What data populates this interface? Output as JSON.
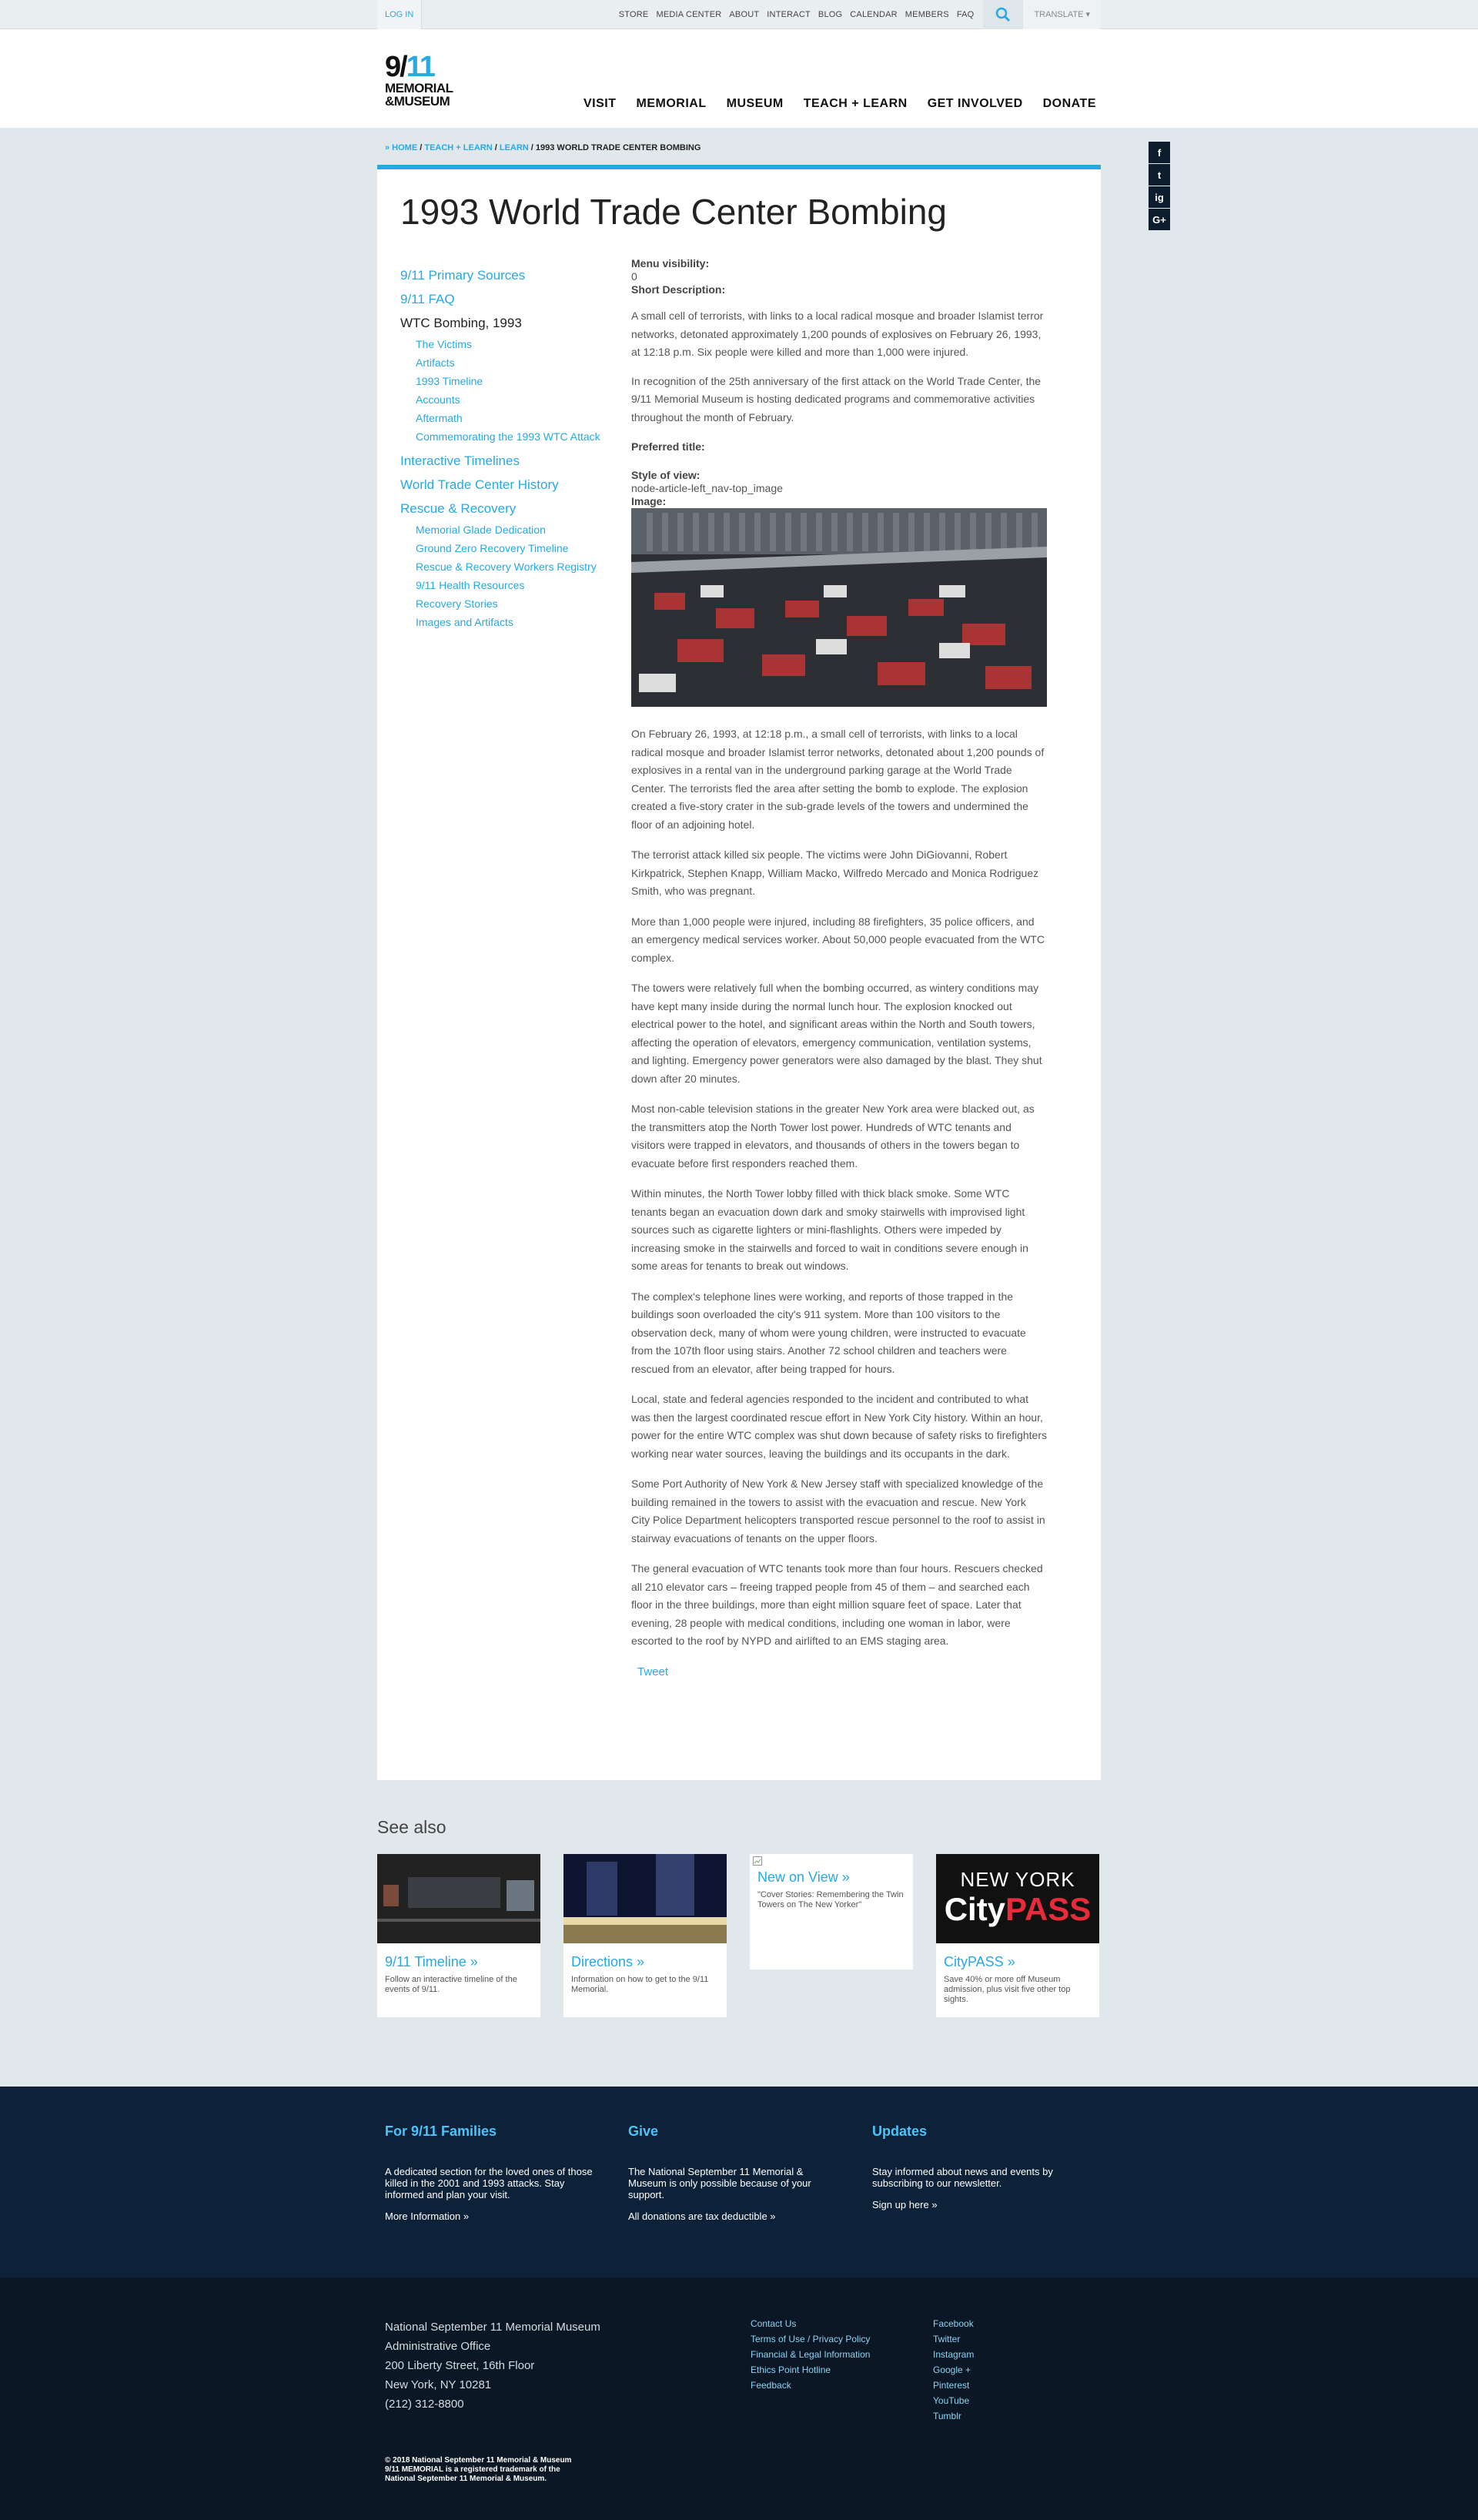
{
  "utility": {
    "login": "LOG IN",
    "links": [
      "STORE",
      "MEDIA CENTER",
      "ABOUT",
      "INTERACT",
      "BLOG",
      "CALENDAR",
      "MEMBERS",
      "FAQ"
    ],
    "translate": "TRANSLATE ▾"
  },
  "logo": {
    "num_left": "9/",
    "num_right": "11",
    "line1": "MEMORIAL",
    "line2": "&MUSEUM"
  },
  "main_nav": [
    "VISIT",
    "MEMORIAL",
    "MUSEUM",
    "TEACH + LEARN",
    "GET INVOLVED",
    "DONATE"
  ],
  "breadcrumb": {
    "home": "» HOME",
    "teach": "TEACH + LEARN",
    "learn": "LEARN",
    "current": "1993 WORLD TRADE CENTER BOMBING",
    "sep": " / "
  },
  "social": [
    "f",
    "t",
    "ig",
    "G+"
  ],
  "page_title": "1993 World Trade Center Bombing",
  "left_nav": {
    "primary_sources": "9/11 Primary Sources",
    "faq": "9/11 FAQ",
    "wtc_bombing": "WTC Bombing, 1993",
    "wtc_children": [
      "The Victims",
      "Artifacts",
      "1993 Timeline",
      "Accounts",
      "Aftermath",
      "Commemorating the 1993 WTC Attack"
    ],
    "interactive": "Interactive Timelines",
    "wtc_history": "World Trade Center History",
    "rescue": "Rescue & Recovery",
    "rescue_children": [
      "Memorial Glade Dedication",
      "Ground Zero Recovery Timeline",
      "Rescue & Recovery Workers Registry",
      "9/11 Health Resources",
      "Recovery Stories",
      "Images and Artifacts"
    ]
  },
  "article": {
    "menu_visibility_label": "Menu visibility:",
    "menu_visibility_value": "0",
    "short_desc_label": "Short Description:",
    "short_desc_p1": "A small cell of terrorists, with links to a local radical mosque and broader Islamist terror networks, detonated approximately 1,200 pounds of explosives on February 26, 1993, at 12:18 p.m. Six people were killed and more than 1,000 were injured.",
    "short_desc_p2": "In recognition of the 25th anniversary of the first attack on the World Trade Center, the 9/11 Memorial Museum is hosting dedicated programs and commemorative activities throughout the month of February.",
    "preferred_title_label": "Preferred title:",
    "style_label": "Style of view:",
    "style_value": "node-article-left_nav-top_image",
    "image_label": "Image:",
    "body": [
      "On February 26, 1993, at 12:18 p.m., a small cell of terrorists, with links to a local radical mosque and broader Islamist terror networks, detonated about 1,200 pounds of explosives in a rental van in the underground parking garage at the World Trade Center. The terrorists fled the area after setting the bomb to explode. The explosion created a five-story crater in the sub-grade levels of the towers and undermined the floor of an adjoining hotel.",
      "The terrorist attack killed six people. The victims were John DiGiovanni, Robert Kirkpatrick, Stephen Knapp, William Macko, Wilfredo Mercado and Monica Rodriguez Smith, who was pregnant.",
      "More than 1,000 people were injured, including 88 firefighters, 35 police officers, and an emergency medical services worker. About 50,000 people evacuated from the WTC complex.",
      "The towers were relatively full when the bombing occurred, as wintery conditions may have kept many inside during the normal lunch hour. The explosion knocked out electrical power to the hotel, and significant areas within the North and South towers, affecting the operation of elevators, emergency communication, ventilation systems, and lighting. Emergency power generators were also damaged by the blast. They shut down after 20 minutes.",
      "Most non-cable television stations in the greater New York area were blacked out, as the transmitters atop the North Tower lost power. Hundreds of WTC tenants and visitors were trapped in elevators, and thousands of others in the towers began to evacuate before first responders reached them.",
      "Within minutes, the North Tower lobby filled with thick black smoke. Some WTC tenants began an evacuation down dark and smoky stairwells with improvised light sources such as cigarette lighters or mini-flashlights. Others were impeded by increasing smoke in the stairwells and forced to wait in conditions severe enough in some areas for tenants to break out windows.",
      "The complex's telephone lines were working, and reports of those trapped in the buildings soon overloaded the city's 911 system. More than 100 visitors to the observation deck, many of whom were young children, were instructed to evacuate from the 107th floor using stairs. Another 72 school children and teachers were rescued from an elevator, after being trapped for hours.",
      "Local, state and federal agencies responded to the incident and contributed to what was then the largest coordinated rescue effort in New York City history. Within an hour, power for the entire WTC complex was shut down because of safety risks to firefighters working near water sources, leaving the buildings and its occupants in the dark.",
      "Some Port Authority of New York & New Jersey staff with specialized knowledge of the building remained in the towers to assist with the evacuation and rescue. New York City Police Department helicopters transported rescue personnel to the roof to assist in stairway evacuations of tenants on the upper floors.",
      "The general evacuation of WTC tenants took more than four hours. Rescuers checked all 210 elevator cars – freeing trapped people from 45 of them – and searched each floor in the three buildings, more than eight million square feet of space. Later that evening, 28 people with medical conditions, including one woman in labor, were escorted to the roof by NYPD and airlifted to an EMS staging area."
    ],
    "tweet": "Tweet"
  },
  "see_also": {
    "title": "See also",
    "tiles": [
      {
        "title": "9/11 Timeline »",
        "desc": "Follow an interactive timeline of the events of 9/11."
      },
      {
        "title": "Directions »",
        "desc": "Information on how to get to the 9/11 Memorial."
      },
      {
        "title": "New on View »",
        "desc": "\"Cover Stories: Remembering the Twin Towers on The New Yorker\""
      },
      {
        "title": "CityPASS »",
        "desc": "Save 40% or more off Museum admission, plus visit five other top sights.",
        "img_text1": "NEW YORK",
        "img_text2": "City",
        "img_text3": "PASS"
      }
    ]
  },
  "footer_top": {
    "families": {
      "title": "For 9/11 Families",
      "text": "A dedicated section for the loved ones of those killed in the 2001 and 1993 attacks. Stay informed and plan your visit.",
      "link": "More Information »"
    },
    "give": {
      "title": "Give",
      "text": "The National September 11 Memorial & Museum is only possible because of your support.",
      "link": "All donations are tax deductible »"
    },
    "updates": {
      "title": "Updates",
      "text": "Stay informed about news and events by subscribing to our newsletter.",
      "link": "Sign up here »"
    }
  },
  "footer_bottom": {
    "address": [
      "National September 11 Memorial Museum",
      "Administrative Office",
      "200 Liberty Street, 16th Floor",
      "New York, NY 10281",
      "(212) 312-8800"
    ],
    "links": [
      "Contact Us",
      "Terms of Use / Privacy Policy",
      "Financial & Legal Information",
      "Ethics Point Hotline",
      "Feedback"
    ],
    "social": [
      "Facebook",
      "Twitter",
      "Instagram",
      "Google +",
      "Pinterest",
      "YouTube",
      "Tumblr"
    ],
    "copyright": [
      "© 2018 National September 11 Memorial & Museum",
      "9/11 MEMORIAL is a registered trademark of the",
      "National September 11 Memorial & Museum."
    ]
  },
  "colors": {
    "accent": "#27a9e1",
    "footer_top": "#0d2239",
    "footer_bottom": "#0b1724",
    "page_bg": "#e1e8ec"
  }
}
